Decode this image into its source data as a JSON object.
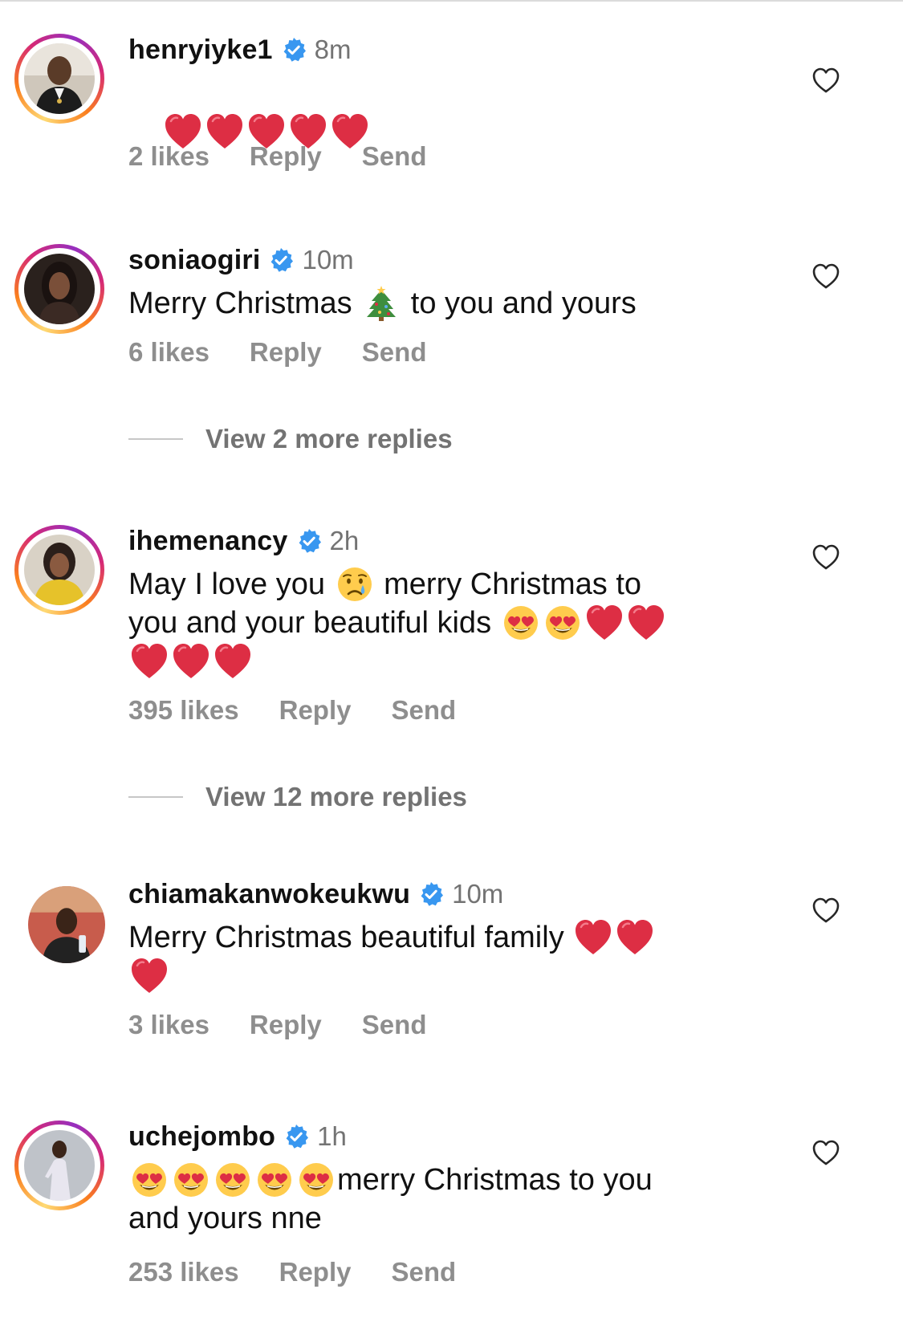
{
  "actions": {
    "reply_label": "Reply",
    "send_label": "Send"
  },
  "colors": {
    "verified": "#3897f0",
    "heart_emoji": "#dd2e44",
    "muted_text": "#737373",
    "action_text": "#8e8e8e"
  },
  "icons": {
    "verified": "verified-badge-icon",
    "like": "heart-outline-icon",
    "red_heart": "red-heart-emoji",
    "heart_eyes": "heart-eyes-emoji",
    "crying": "crying-face-emoji",
    "tree": "christmas-tree-emoji"
  },
  "comments": [
    {
      "username": "henryiyke1",
      "time": "8m",
      "text_segments": [
        "",
        "❤️❤️❤️❤️❤️"
      ],
      "likes": "2 likes"
    },
    {
      "username": "soniaogiri",
      "time": "10m",
      "text_before": "Merry Christmas ",
      "text_after": " to you and yours",
      "likes": "6 likes",
      "view_replies": "View 2 more replies"
    },
    {
      "username": "ihemenancy",
      "time": "2h",
      "line1_before": "May I love you ",
      "line1_after": " merry Christmas to",
      "line2": "you and your beautiful kids ",
      "likes": "395 likes",
      "view_replies": "View 12 more replies"
    },
    {
      "username": "chiamakanwokeukwu",
      "time": "10m",
      "text": "Merry Christmas beautiful family ",
      "likes": "3 likes"
    },
    {
      "username": "uchejombo",
      "time": "1h",
      "text_after": "merry Christmas to you",
      "line2": "and yours nne",
      "likes": "253 likes"
    }
  ]
}
